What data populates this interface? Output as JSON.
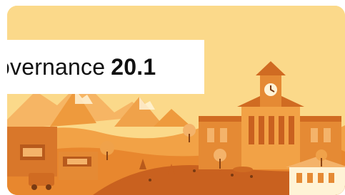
{
  "banner": {
    "title_text": "overnance",
    "version": "20.1"
  },
  "illustration": {
    "description_icon": "town-illustration",
    "colors": {
      "sky": "#fbd98a",
      "mountain_far": "#f6b564",
      "mountain_near": "#ee9a3d",
      "hill_orange": "#e8872e",
      "hill_dark": "#c9611f",
      "building_main": "#e58a34",
      "building_roof": "#d06b22",
      "building_light": "#f4b36a",
      "cream": "#fff3d6"
    }
  }
}
